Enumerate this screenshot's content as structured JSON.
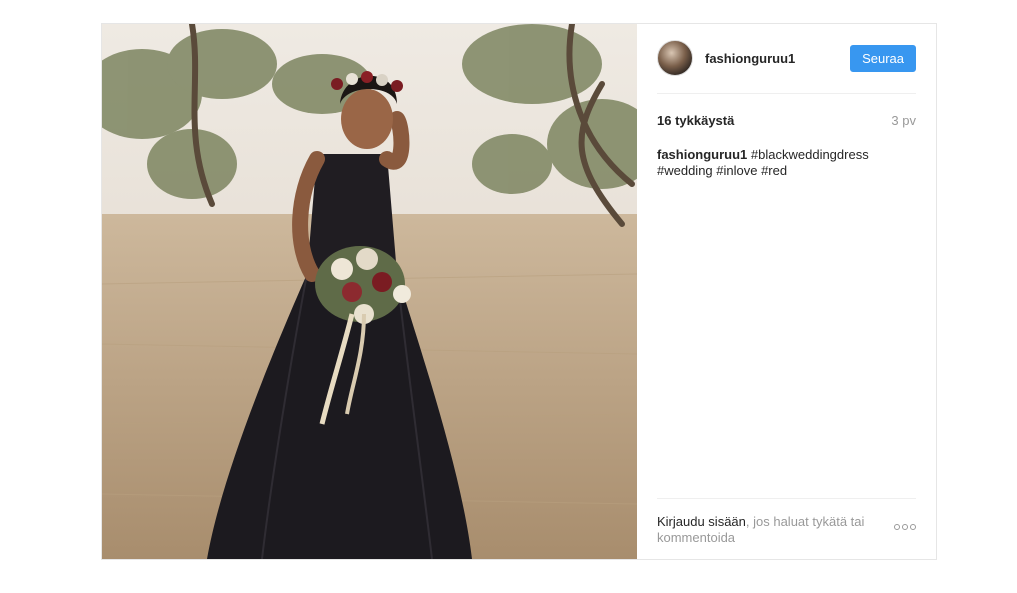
{
  "post": {
    "username": "fashionguruu1",
    "follow_label": "Seuraa",
    "likes": "16 tykkäystä",
    "time": "3 pv",
    "caption_user": "fashionguruu1",
    "caption_text_line1": "#blackweddingdress",
    "caption_text_line2": "#wedding #inlove #red",
    "login_link": "Kirjaudu sisään",
    "login_rest": ", jos haluat tykätä tai kommentoida",
    "photo_subject": "bride-in-black-dress"
  },
  "colors": {
    "accent": "#3897f0",
    "muted_text": "#999999",
    "border": "#e6e6e6"
  }
}
